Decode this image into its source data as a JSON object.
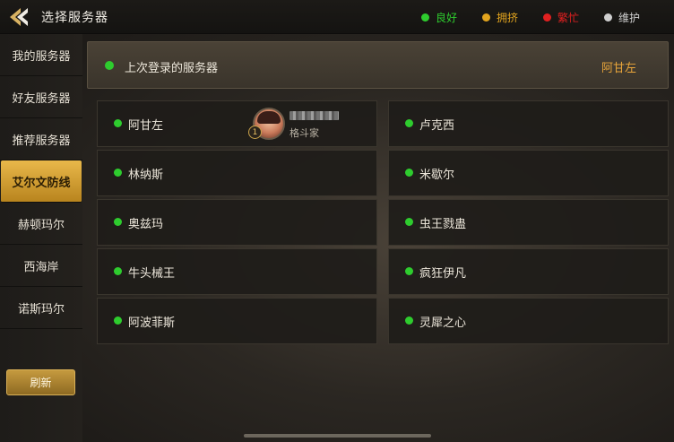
{
  "header": {
    "title": "选择服务器",
    "legend": [
      {
        "label": "良好",
        "color": "#2ecc2e"
      },
      {
        "label": "拥挤",
        "color": "#e2a41e"
      },
      {
        "label": "繁忙",
        "color": "#e02020"
      },
      {
        "label": "维护",
        "color": "#cfcfcf"
      }
    ]
  },
  "sidebar": {
    "items": [
      {
        "label": "我的服务器"
      },
      {
        "label": "好友服务器"
      },
      {
        "label": "推荐服务器"
      },
      {
        "label": "艾尔文防线",
        "active": true
      },
      {
        "label": "赫顿玛尔"
      },
      {
        "label": "西海岸"
      },
      {
        "label": "诺斯玛尔"
      }
    ],
    "refresh_label": "刷新"
  },
  "last_login": {
    "label": "上次登录的服务器",
    "server": "阿甘左",
    "status_color": "#2ecc2e"
  },
  "servers": [
    {
      "name": "阿甘左",
      "status_color": "#2ecc2e"
    },
    {
      "name": "卢克西",
      "status_color": "#2ecc2e"
    },
    {
      "name": "林纳斯",
      "status_color": "#2ecc2e"
    },
    {
      "name": "米歇尔",
      "status_color": "#2ecc2e"
    },
    {
      "name": "奥兹玛",
      "status_color": "#2ecc2e"
    },
    {
      "name": "虫王戮蛊",
      "status_color": "#2ecc2e"
    },
    {
      "name": "牛头械王",
      "status_color": "#2ecc2e"
    },
    {
      "name": "疯狂伊凡",
      "status_color": "#2ecc2e"
    },
    {
      "name": "阿波菲斯",
      "status_color": "#2ecc2e"
    },
    {
      "name": "灵犀之心",
      "status_color": "#2ecc2e"
    }
  ],
  "character": {
    "level": "1",
    "class": "格斗家"
  }
}
